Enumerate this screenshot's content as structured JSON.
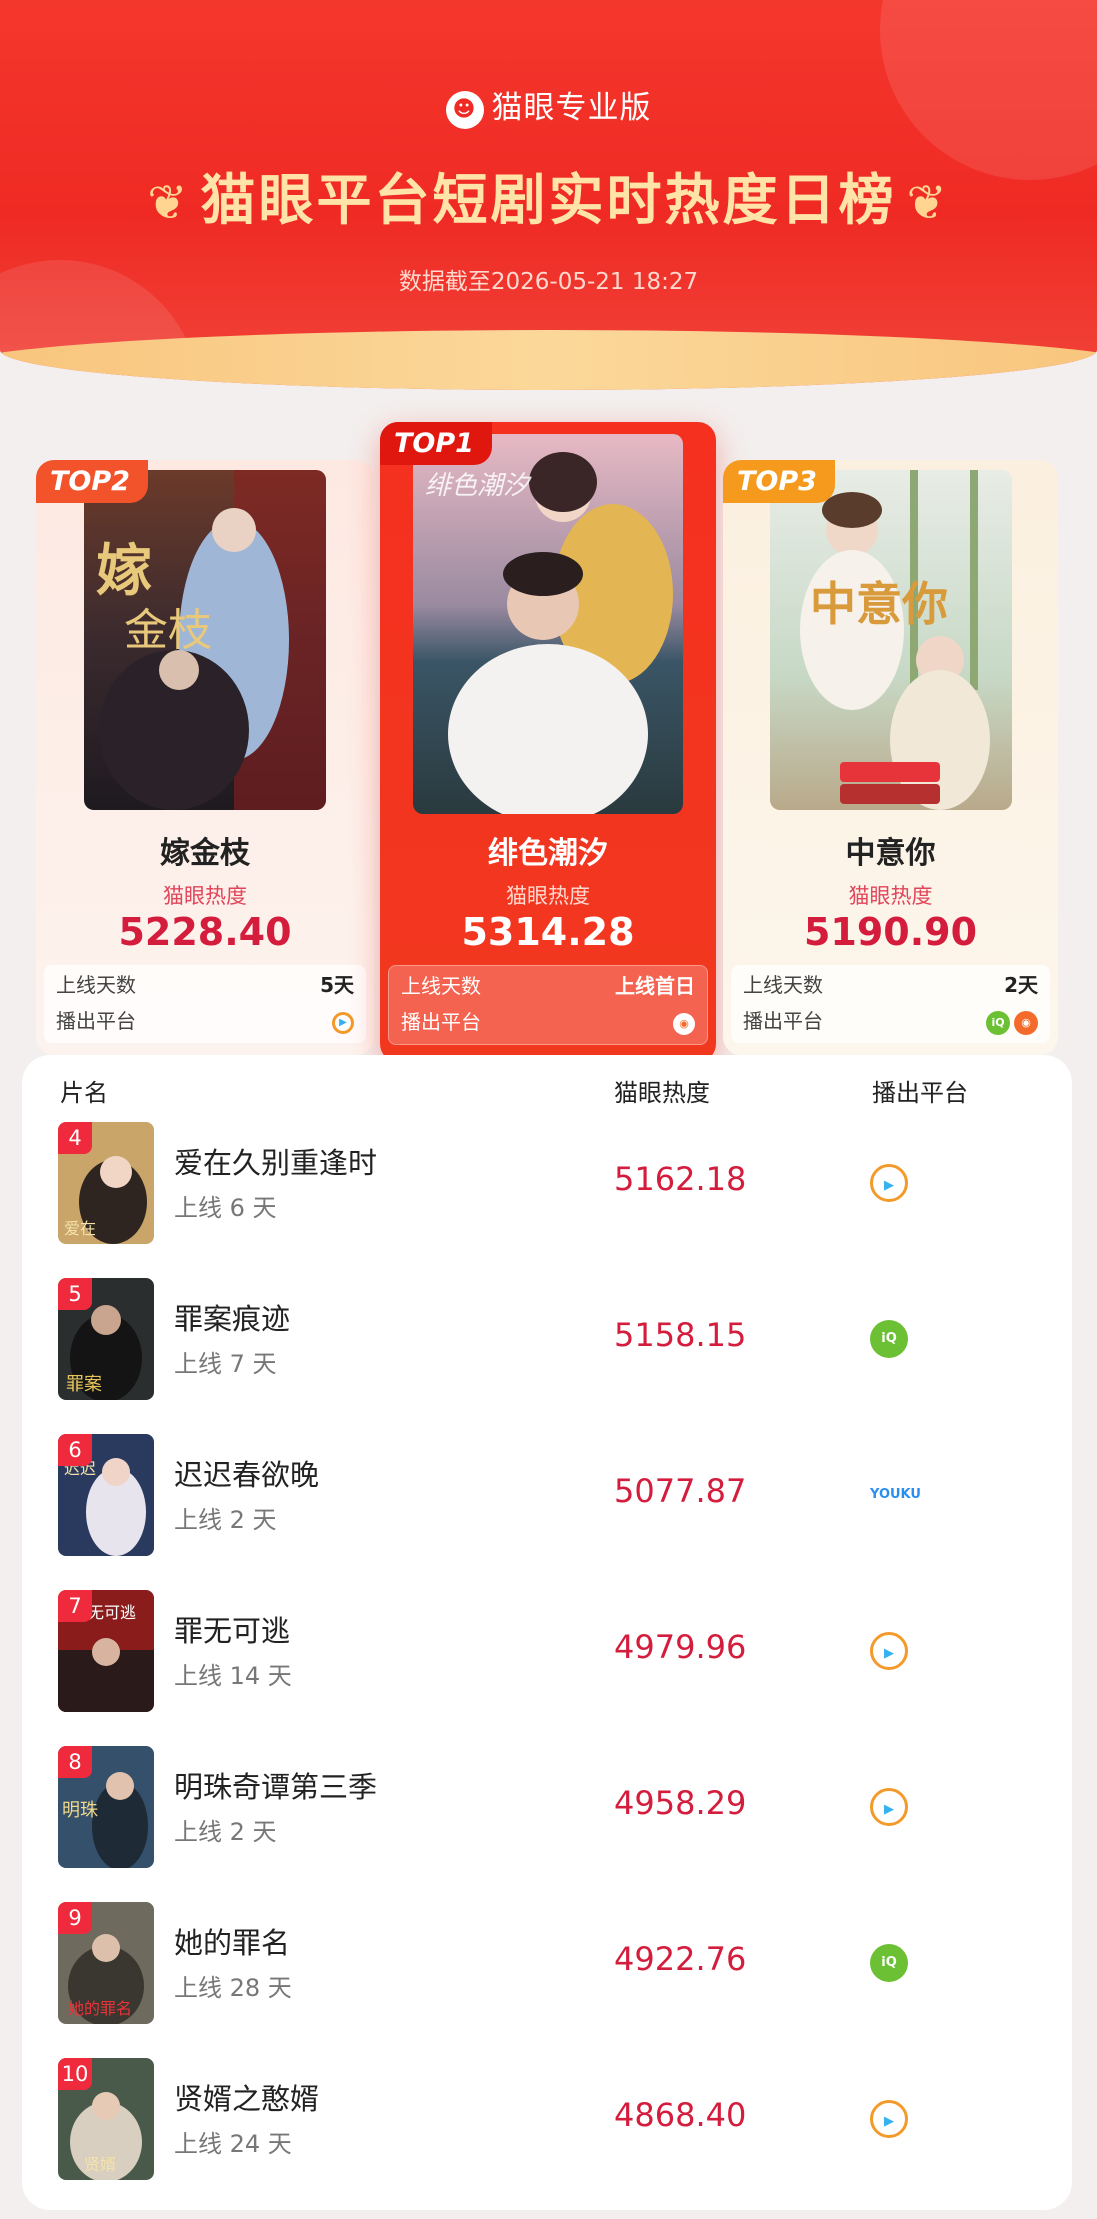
{
  "header": {
    "brand": "猫眼专业版",
    "title": "猫眼平台短剧实时热度日榜",
    "timestamp": "数据截至2026-05-21 18:27"
  },
  "top": [
    {
      "rank_label": "TOP2",
      "title": "嫁金枝",
      "heat_label": "猫眼热度",
      "heat": "5228.40",
      "days_label": "上线天数",
      "days": "5天",
      "platform_label": "播出平台",
      "platforms": [
        "tencent-video-icon"
      ]
    },
    {
      "rank_label": "TOP1",
      "title": "绯色潮汐",
      "heat_label": "猫眼热度",
      "heat": "5314.28",
      "days_label": "上线天数",
      "days": "上线首日",
      "platform_label": "播出平台",
      "platforms": [
        "mango-tv-icon"
      ]
    },
    {
      "rank_label": "TOP3",
      "title": "中意你",
      "heat_label": "猫眼热度",
      "heat": "5190.90",
      "days_label": "上线天数",
      "days": "2天",
      "platform_label": "播出平台",
      "platforms": [
        "iqiyi-icon",
        "mango-tv-icon"
      ]
    }
  ],
  "list": {
    "col_title": "片名",
    "col_heat": "猫眼热度",
    "col_platform": "播出平台",
    "rows": [
      {
        "rank": "4",
        "title": "爱在久别重逢时",
        "days": "上线 6 天",
        "heat": "5162.18",
        "platform": "tencent-video-icon"
      },
      {
        "rank": "5",
        "title": "罪案痕迹",
        "days": "上线 7 天",
        "heat": "5158.15",
        "platform": "iqiyi-icon"
      },
      {
        "rank": "6",
        "title": "迟迟春欲晚",
        "days": "上线 2 天",
        "heat": "5077.87",
        "platform": "youku-icon"
      },
      {
        "rank": "7",
        "title": "罪无可逃",
        "days": "上线 14 天",
        "heat": "4979.96",
        "platform": "tencent-video-icon"
      },
      {
        "rank": "8",
        "title": "明珠奇谭第三季",
        "days": "上线 2 天",
        "heat": "4958.29",
        "platform": "tencent-video-icon"
      },
      {
        "rank": "9",
        "title": "她的罪名",
        "days": "上线 28 天",
        "heat": "4922.76",
        "platform": "iqiyi-icon"
      },
      {
        "rank": "10",
        "title": "贤婿之憨婿",
        "days": "上线 24 天",
        "heat": "4868.40",
        "platform": "tencent-video-icon"
      }
    ]
  },
  "colors": {
    "brand_red": "#ef2a24",
    "heat_red": "#d41c3c",
    "gold": "#ffe3a8"
  }
}
